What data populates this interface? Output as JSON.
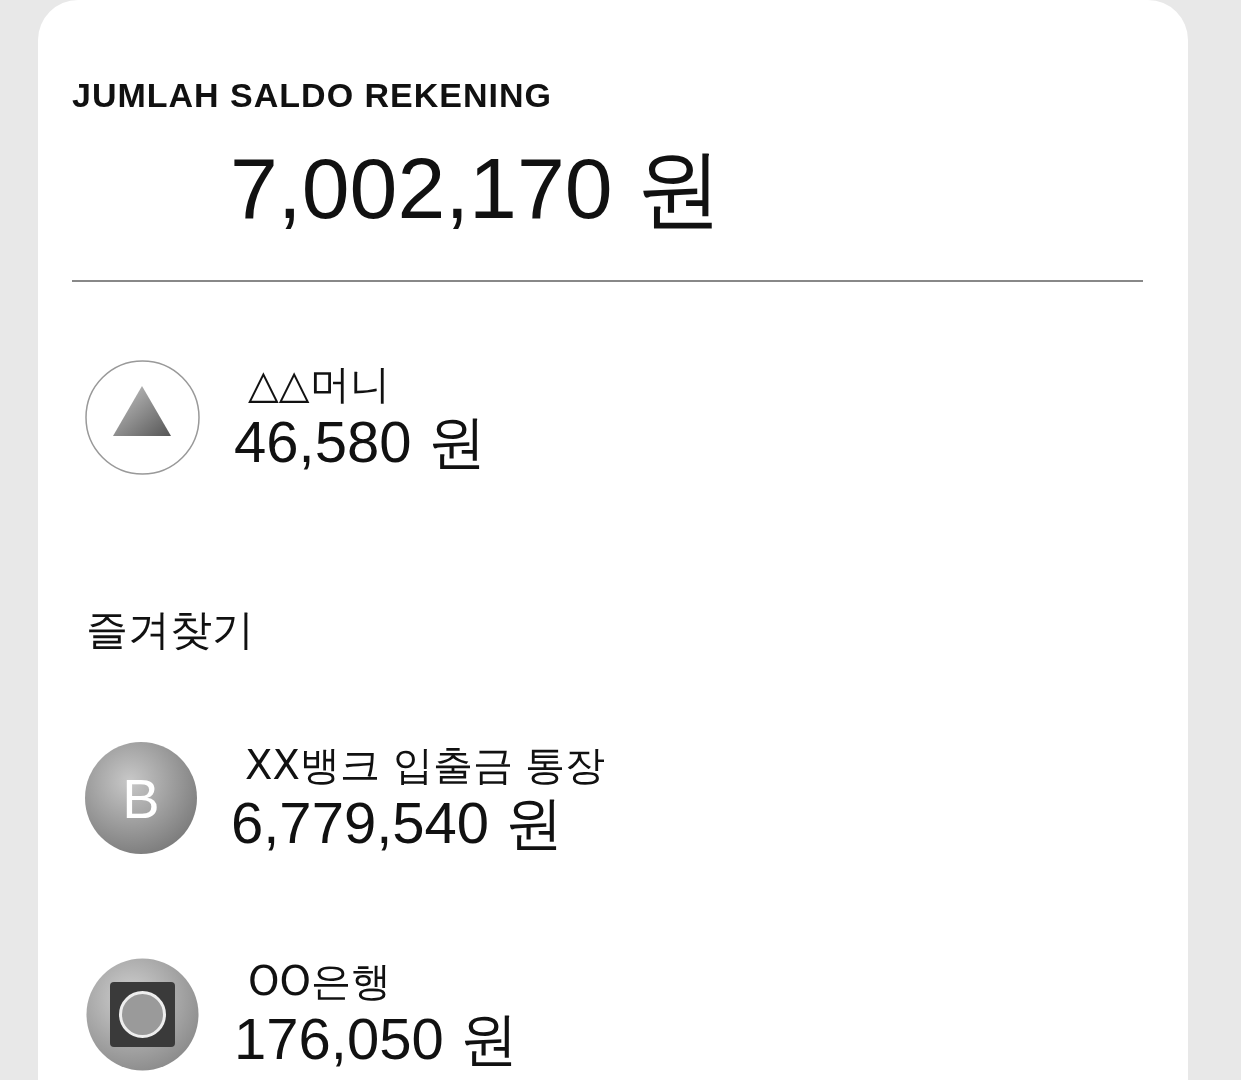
{
  "balance": {
    "title": "JUMLAH SALDO REKENING",
    "amount": "7,002,170 원"
  },
  "main_account": {
    "kind": "triangle",
    "name": "△△머니",
    "amount": "46,580 원"
  },
  "favorites": {
    "title": "즐겨찾기",
    "accounts": [
      {
        "kind": "letter",
        "letter": "B",
        "name": "XX뱅크 입출금 통장",
        "amount": "6,779,540 원"
      },
      {
        "kind": "square",
        "name": "OO은행",
        "amount": "176,050 원"
      }
    ]
  }
}
